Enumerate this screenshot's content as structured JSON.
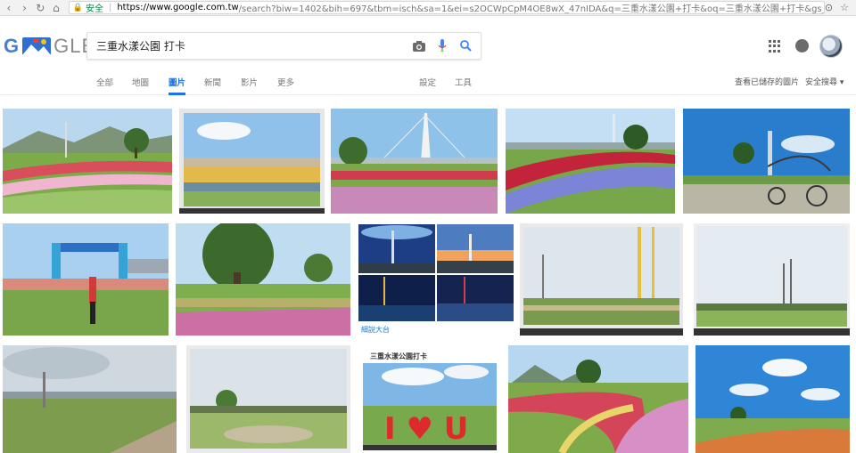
{
  "browser": {
    "secure_label": "安全",
    "url_host": "https://www.google.com.tw",
    "url_rest": "/search?biw=1402&bih=697&tbm=isch&sa=1&ei=s2OCWpCpM4OE8wX_47nIDA&q=三重水漾公園+打卡&oq=三重水漾公園+打卡&gs_l=psy-ab.3..."
  },
  "logo": {
    "first": "G",
    "rest": "GLE",
    "colors": [
      "#4a7ecf",
      "#8a8a8a"
    ]
  },
  "search": {
    "query": "三重水漾公園 打卡",
    "icons": [
      "camera-icon",
      "microphone-icon",
      "search-icon"
    ]
  },
  "tabs": [
    {
      "label": "全部"
    },
    {
      "label": "地圖"
    },
    {
      "label": "圖片",
      "active": true
    },
    {
      "label": "新聞"
    },
    {
      "label": "影片"
    },
    {
      "label": "更多"
    }
  ],
  "tools": {
    "settings": "設定",
    "tools": "工具"
  },
  "right_links": {
    "saved": "查看已儲存的圖片",
    "safe_search": "安全搜尋 ▾"
  },
  "thumb_text": {
    "row2_col3_caption": "細說大台",
    "row3_col3_banner": "三重水漾公園打卡",
    "row3_col3_letters": "I ♥ U"
  },
  "colors": {
    "accent": "#1a73e8",
    "secure": "#0b8043"
  }
}
